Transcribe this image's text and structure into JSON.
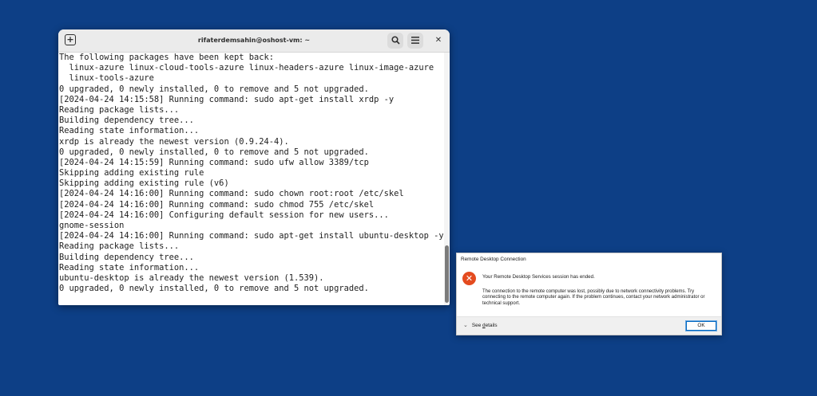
{
  "terminal": {
    "title": "rifaterdemsahin@oshost-vm: ~",
    "new_tab_icon": "new-tab-icon",
    "search_icon": "search-icon",
    "menu_icon": "hamburger-menu-icon",
    "close_icon": "close-icon",
    "lines": [
      "The following packages have been kept back:",
      "  linux-azure linux-cloud-tools-azure linux-headers-azure linux-image-azure",
      "  linux-tools-azure",
      "0 upgraded, 0 newly installed, 0 to remove and 5 not upgraded.",
      "[2024-04-24 14:15:58] Running command: sudo apt-get install xrdp -y",
      "Reading package lists...",
      "Building dependency tree...",
      "Reading state information...",
      "xrdp is already the newest version (0.9.24-4).",
      "0 upgraded, 0 newly installed, 0 to remove and 5 not upgraded.",
      "[2024-04-24 14:15:59] Running command: sudo ufw allow 3389/tcp",
      "Skipping adding existing rule",
      "Skipping adding existing rule (v6)",
      "[2024-04-24 14:16:00] Running command: sudo chown root:root /etc/skel",
      "[2024-04-24 14:16:00] Running command: sudo chmod 755 /etc/skel",
      "[2024-04-24 14:16:00] Configuring default session for new users...",
      "gnome-session",
      "[2024-04-24 14:16:00] Running command: sudo apt-get install ubuntu-desktop -y",
      "Reading package lists...",
      "Building dependency tree...",
      "Reading state information...",
      "ubuntu-desktop is already the newest version (1.539).",
      "0 upgraded, 0 newly installed, 0 to remove and 5 not upgraded."
    ]
  },
  "dialog": {
    "title": "Remote Desktop Connection",
    "icon": "error-icon",
    "message": "Your Remote Desktop Services session has ended.",
    "detail": "The connection to the remote computer was lost, possibly due to network connectivity problems. Try connecting to the remote computer again. If the problem continues, contact your network administrator or technical support.",
    "see_details_prefix": "See ",
    "see_details_underlined": "d",
    "see_details_suffix": "etails",
    "ok_label": "OK"
  },
  "colors": {
    "desktop": "#0d3f86",
    "error": "#e44b1f",
    "ok_border": "#0067c0"
  }
}
